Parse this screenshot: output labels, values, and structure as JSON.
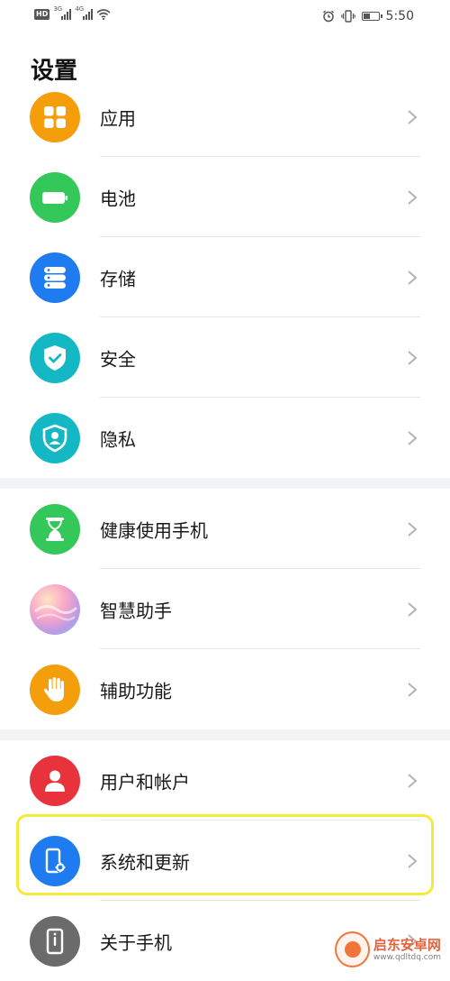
{
  "status_bar": {
    "hd_label": "HD",
    "signal1_label": "3G",
    "signal2_label": "4G",
    "time": "5:50"
  },
  "page": {
    "title": "设置"
  },
  "groups": [
    {
      "items": [
        {
          "label": "应用",
          "icon": "apps-icon",
          "color": "#f59e0b"
        },
        {
          "label": "电池",
          "icon": "battery-icon",
          "color": "#34c759"
        },
        {
          "label": "存储",
          "icon": "storage-icon",
          "color": "#1e7bf0"
        },
        {
          "label": "安全",
          "icon": "shield-check-icon",
          "color": "#14b8c4"
        },
        {
          "label": "隐私",
          "icon": "privacy-shield-icon",
          "color": "#14b8c4"
        }
      ]
    },
    {
      "items": [
        {
          "label": "健康使用手机",
          "icon": "hourglass-icon",
          "color": "#34c759"
        },
        {
          "label": "智慧助手",
          "icon": "assistant-orb-icon",
          "color": "#c8a0e0"
        },
        {
          "label": "辅助功能",
          "icon": "hand-icon",
          "color": "#f59e0b"
        }
      ]
    },
    {
      "items": [
        {
          "label": "用户和帐户",
          "icon": "user-icon",
          "color": "#e8323c"
        },
        {
          "label": "系统和更新",
          "icon": "phone-settings-icon",
          "color": "#1e7bf0"
        },
        {
          "label": "关于手机",
          "icon": "phone-info-icon",
          "color": "#6b6b6b"
        }
      ]
    }
  ],
  "watermark": {
    "name": "启东安卓网",
    "url": "www.qdltdq.com"
  }
}
